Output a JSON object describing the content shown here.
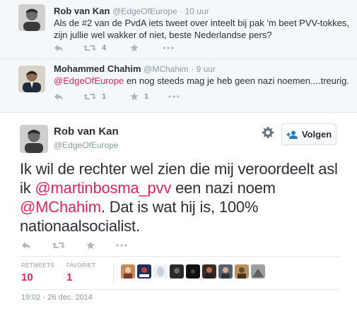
{
  "tweet1": {
    "name": "Rob van Kan",
    "handle": "@EdgeOfEurope",
    "time": "· 10 uur",
    "text": "Als de #2 van de PvdA iets tweet over inteelt bij pak 'm beet PVV-tokkes, zijn jullie wel wakker of niet, beste Nederlandse pers?",
    "retweets": "4"
  },
  "tweet2": {
    "name": "Mohammed Chahim",
    "handle": "@MChahim",
    "time": "· 9 uur",
    "mention": "@EdgeOfEurope",
    "text": " en nog steeds mag je heb geen nazi noemen....treurig.",
    "retweets": "1",
    "favorites": "1"
  },
  "main": {
    "name": "Rob van Kan",
    "handle": "@EdgeOfEurope",
    "follow_label": "Volgen",
    "text_1": "Ik wil de rechter wel zien die mij veroordeelt asl ik ",
    "mention_1": "@martinbosma_pvv",
    "text_2": " een nazi noem ",
    "mention_2": "@MChahim",
    "text_3": ". Dat is wat hij is, 100% nationaalsocialist.",
    "retweets_label": "RETWEETS",
    "retweets_value": "10",
    "favorites_label": "FAVORIET",
    "favorites_value": "1",
    "timestamp": "19:02 - 26 dec. 2014"
  },
  "colors": {
    "accent": "#e0245e",
    "muted": "#8899a6",
    "icon": "#aab8c2"
  },
  "icons": [
    "reply-icon",
    "retweet-icon",
    "star-icon",
    "more-icon",
    "gear-icon",
    "add-user-icon"
  ]
}
